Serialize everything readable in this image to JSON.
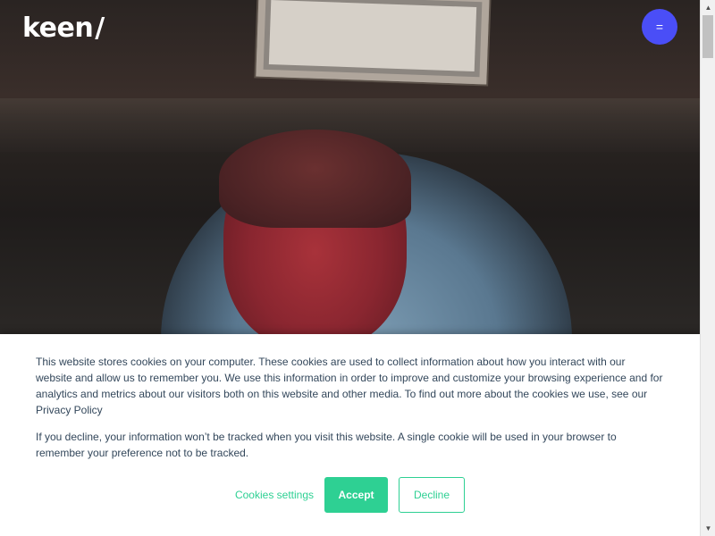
{
  "brand": {
    "logo_text": "keen",
    "logo_slash": "/"
  },
  "header": {
    "menu_icon_glyph": "=",
    "menu_button_color": "#4a4ef7"
  },
  "cookie_banner": {
    "paragraph_1": "This website stores cookies on your computer. These cookies are used to collect information about how you interact with our website and allow us to remember you. We use this information in order to improve and customize your browsing experience and for analytics and metrics about our visitors both on this website and other media. To find out more about the cookies we use, see our Privacy Policy",
    "paragraph_2": "If you decline, your information won’t be tracked when you visit this website. A single cookie will be used in your browser to remember your preference not to be tracked.",
    "settings_label": "Cookies settings",
    "accept_label": "Accept",
    "decline_label": "Decline",
    "accent_color": "#2ed093"
  },
  "scrollbar": {
    "up_arrow": "▲",
    "down_arrow": "▼"
  }
}
